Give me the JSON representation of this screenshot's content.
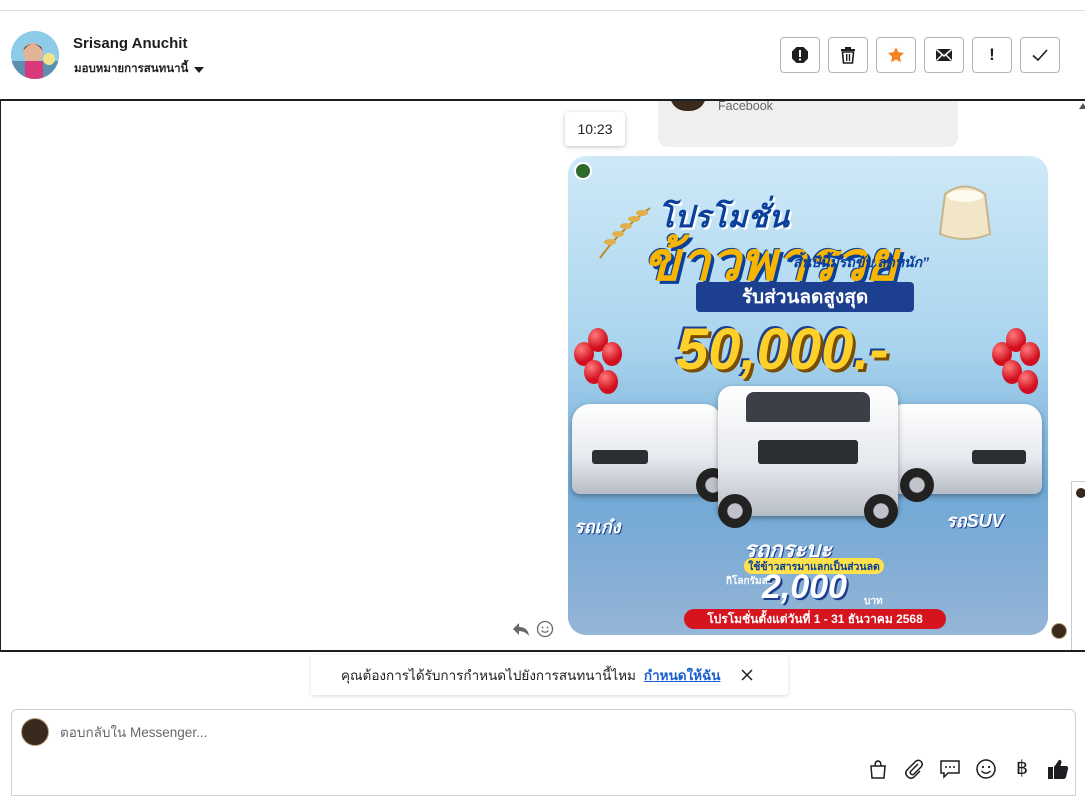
{
  "header": {
    "user_name": "Srisang Anuchit",
    "assign_label": "มอบหมายการสนทนานี้",
    "actions": [
      {
        "name": "spam-icon",
        "label": "spam"
      },
      {
        "name": "trash-icon",
        "label": "delete"
      },
      {
        "name": "star-icon",
        "label": "star"
      },
      {
        "name": "mail-icon",
        "label": "mark-unread"
      },
      {
        "name": "exclamation-icon",
        "label": "follow-up"
      },
      {
        "name": "check-icon",
        "label": "done"
      }
    ],
    "accent": "#f5821f"
  },
  "chat": {
    "previous_card_source": "Facebook",
    "timestamp": "10:23",
    "promo": {
      "title_small": "โปรโมชั่น",
      "title_big": "ข้าวพารวย",
      "tagline": "“สิ้นปีนี้มีรถขับ ลดหนัก”",
      "band": "รับส่วนลดสูงสุด",
      "amount": "50,000.-",
      "label_left": "รถเก๋ง",
      "label_center": "รถกระบะ",
      "label_right": "รถSUV",
      "pill": "ใช้ข้าวสารมาแลกเป็นส่วนลด",
      "per_kg": "กิโลกรัมละ",
      "price": "2,000",
      "baht": "บาท",
      "footer": "โปรโมชั่นตั้งแต่วันที่ 1 - 31 ธันวาคม 2568"
    }
  },
  "assign_toast": {
    "message": "คุณต้องการได้รับการกำหนดไปยังการสนทนานี้ไหม",
    "link": "กำหนดให้ฉัน"
  },
  "composer": {
    "placeholder": "ตอบกลับใน Messenger...",
    "tools": [
      "shopping-bag-icon",
      "paperclip-icon",
      "saved-reply-icon",
      "emoji-icon",
      "baht-icon",
      "like-icon"
    ],
    "baht_glyph": "฿"
  }
}
